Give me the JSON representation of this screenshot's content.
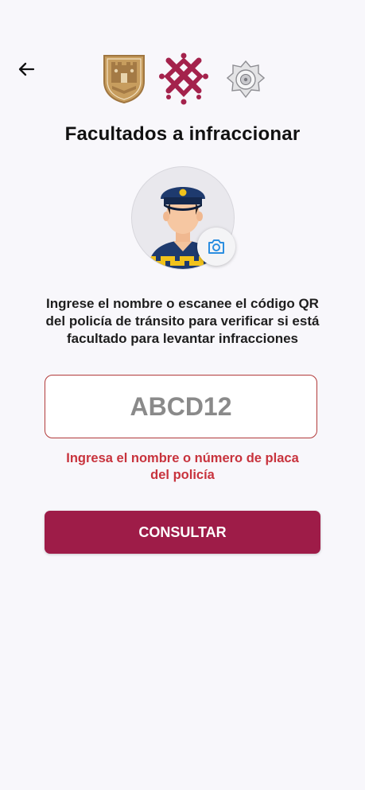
{
  "header": {
    "back_icon": "arrow-left-icon",
    "logos": [
      "cdmx-coat-of-arms-logo",
      "cdmx-government-logo",
      "police-badge-logo"
    ]
  },
  "page": {
    "title": "Facultados a infraccionar"
  },
  "avatar": {
    "icon": "traffic-police-officer-avatar",
    "camera_icon": "camera-icon"
  },
  "instructions": {
    "line1": "Ingrese el nombre o escanee el código QR",
    "line2": "del policía de tránsito para verificar si está",
    "line3": "facultado para levantar infracciones"
  },
  "search": {
    "value": "",
    "placeholder": "ABCD12"
  },
  "error": {
    "line1": "Ingresa el nombre o número de placa",
    "line2": "del policía"
  },
  "actions": {
    "consult_label": "CONSULTAR"
  },
  "colors": {
    "background": "#f8f7fb",
    "primary": "#9e1c48",
    "error": "#c8333d",
    "input_border": "#b23a3a",
    "coat_gold": "#c79d5e",
    "police_blue": "#1e3a6e",
    "police_yellow": "#f1c21b"
  }
}
